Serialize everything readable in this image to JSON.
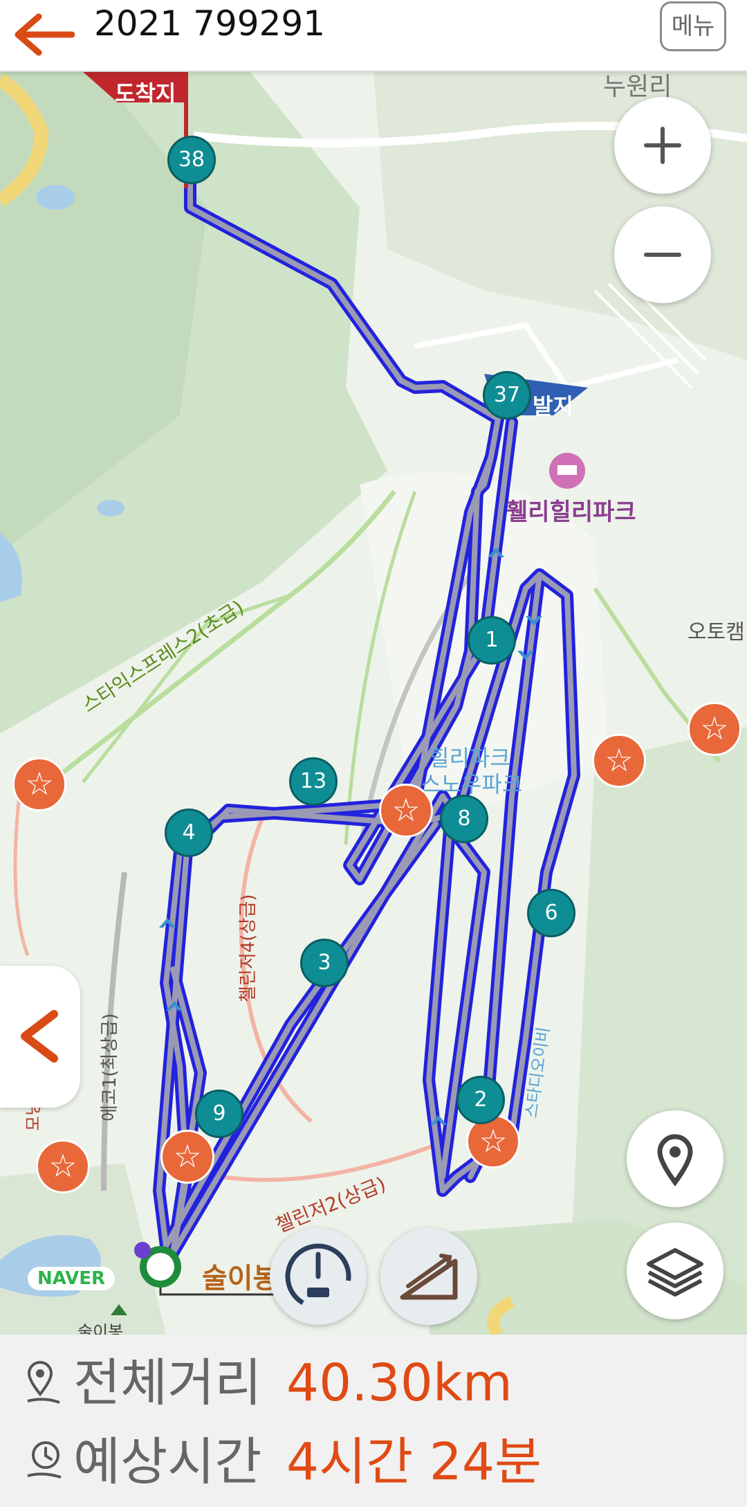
{
  "header": {
    "title": "2021 799291",
    "menu_label": "메뉴"
  },
  "map": {
    "labels": {
      "arrival_flag": "도착지",
      "departure_flag": "발지",
      "village": "누원리",
      "park": "휄리힐리파크",
      "camp": "오토캠",
      "slope_express": "스타익스프레스2(초급)",
      "slope_challenger4": "첼린저4(상급)",
      "slope_challenger2": "첼린저2(상급)",
      "slope_eco1": "에코1(최상급)",
      "slope_small": "모닝",
      "snowpark_a": "힐리파크",
      "snowpark_b": "스노우파크",
      "slope_right": "스타디오이비",
      "naver_logo": "NAVER",
      "place_bottom": "술이봉",
      "place_bottom2": "술이봉"
    },
    "waypoints": [
      {
        "num": "38"
      },
      {
        "num": "37"
      },
      {
        "num": "1"
      },
      {
        "num": "13"
      },
      {
        "num": "4"
      },
      {
        "num": "8"
      },
      {
        "num": "6"
      },
      {
        "num": "3"
      },
      {
        "num": "2"
      },
      {
        "num": "9"
      }
    ],
    "route_color": "#2222dd",
    "route_fill": "#9a9ab4",
    "marker_color": "#0f8d94",
    "star_color": "#e8683a",
    "icons": [
      "zoom-in-icon",
      "zoom-out-icon",
      "location-pin-icon",
      "layers-icon",
      "speedometer-icon",
      "slope-icon",
      "back-arrow-icon",
      "chevron-left-icon"
    ]
  },
  "info": {
    "distance_label": "전체거리",
    "distance_value": "40.30km",
    "time_label": "예상시간",
    "time_value": "4시간 24분",
    "accent": "#e04a14"
  }
}
